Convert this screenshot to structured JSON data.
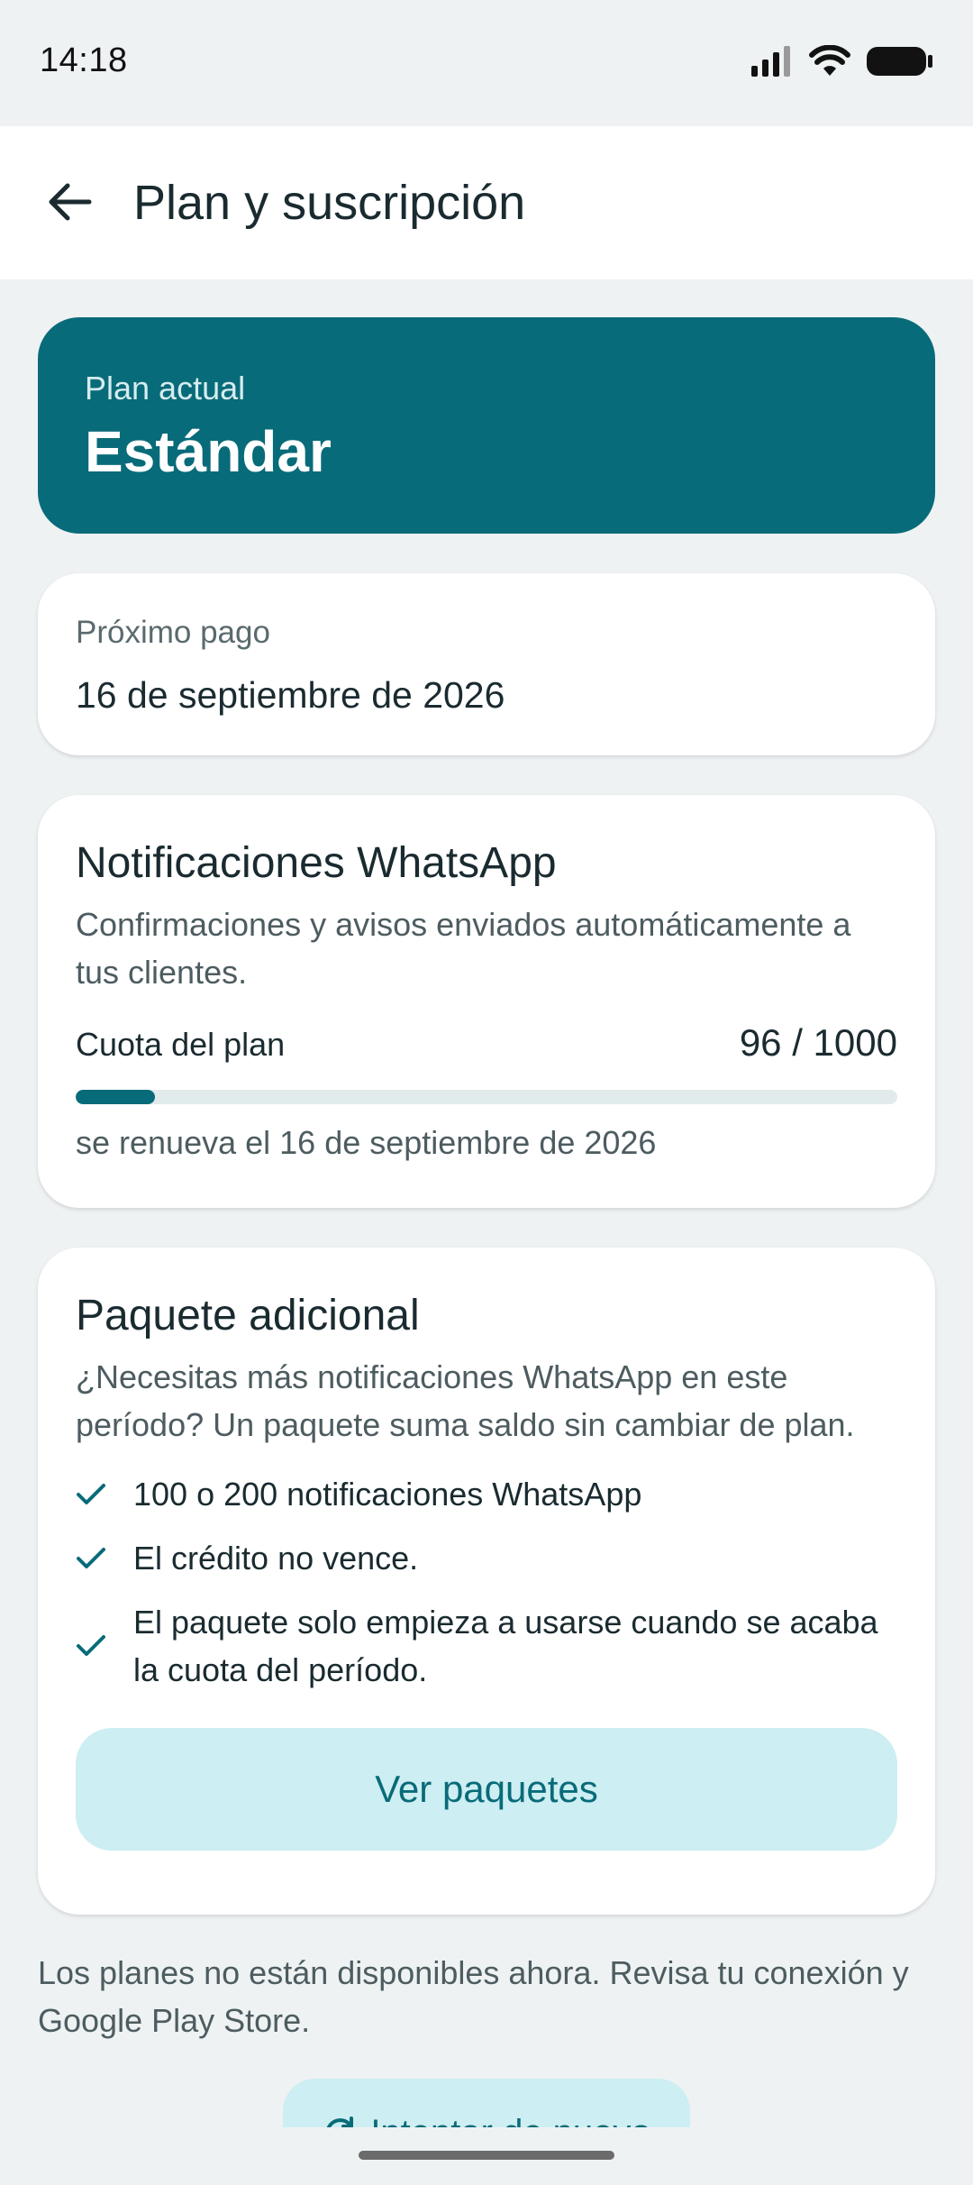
{
  "status_bar": {
    "time": "14:18"
  },
  "app_bar": {
    "title": "Plan y suscripción"
  },
  "plan": {
    "label": "Plan actual",
    "name": "Estándar"
  },
  "payment": {
    "label": "Próximo pago",
    "date": "16 de septiembre de 2026"
  },
  "whatsapp": {
    "title": "Notificaciones WhatsApp",
    "description": "Confirmaciones y avisos enviados automáticamente a tus clientes.",
    "quota_label": "Cuota del plan",
    "quota_value": "96 / 1000",
    "quota_used": 96,
    "quota_total": 1000,
    "renewal": "se renueva el 16 de septiembre de 2026"
  },
  "package": {
    "title": "Paquete adicional",
    "description": "¿Necesitas más notificaciones WhatsApp en este período? Un paquete suma saldo sin cambiar de plan.",
    "features": [
      "100 o 200 notificaciones WhatsApp",
      "El crédito no vence.",
      "El paquete solo empieza a usarse cuando se acaba la cuota del período."
    ],
    "button_label": "Ver paquetes"
  },
  "footer": {
    "note": "Los planes no están disponibles ahora. Revisa tu conexión y Google Play Store.",
    "retry_label": "Intentar de nuevo"
  },
  "colors": {
    "accent": "#086b79",
    "button_bg": "#cdeef2",
    "page_bg": "#eef2f3"
  }
}
